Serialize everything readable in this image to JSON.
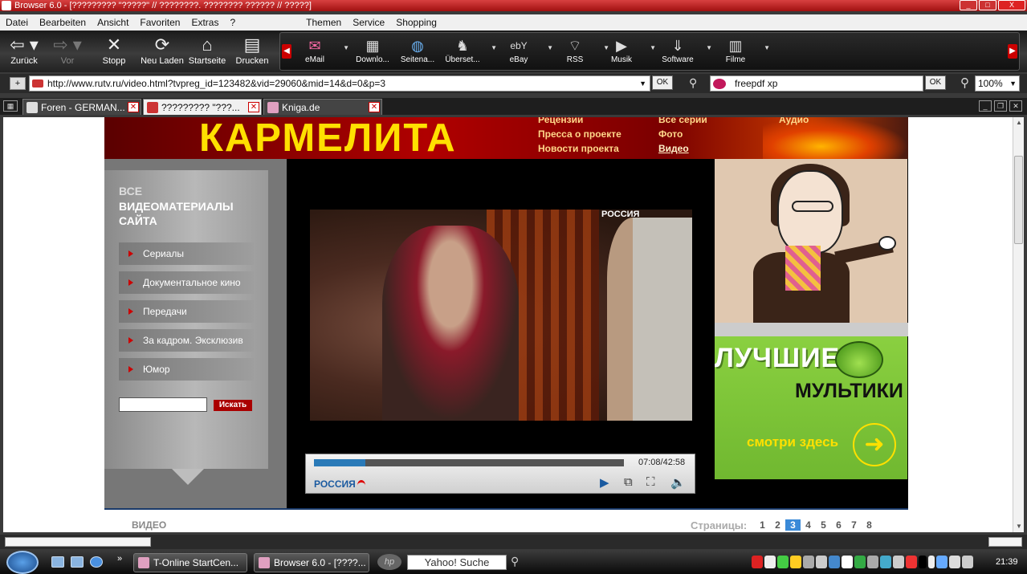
{
  "window": {
    "title": "Browser 6.0 - [????????? \"?????\" // ????????. ???????? ?????? // ?????]",
    "controls": [
      "_",
      "□",
      "X"
    ]
  },
  "menu": {
    "items_left": [
      "Datei",
      "Bearbeiten",
      "Ansicht",
      "Favoriten",
      "Extras",
      "?"
    ],
    "items_right": [
      "Themen",
      "Service",
      "Shopping"
    ]
  },
  "toolbar": {
    "back": "Zurück",
    "forward": "Vor",
    "stop": "Stopp",
    "reload": "Neu Laden",
    "home": "Startseite",
    "print": "Drucken"
  },
  "linkbar": {
    "items": [
      {
        "label": "eMail",
        "icon": "mail-icon"
      },
      {
        "label": "Downlo...",
        "icon": "download-icon"
      },
      {
        "label": "Seitena...",
        "icon": "globe-icon"
      },
      {
        "label": "Überset...",
        "icon": "translate-icon"
      },
      {
        "label": "eBay",
        "icon": "ebay-icon"
      },
      {
        "label": "RSS",
        "icon": "rss-icon"
      },
      {
        "label": "Musik",
        "icon": "music-icon"
      },
      {
        "label": "Software",
        "icon": "software-icon"
      },
      {
        "label": "Filme",
        "icon": "film-icon"
      }
    ]
  },
  "address": {
    "url": "http://www.rutv.ru/video.html?tvpreg_id=123482&vid=29060&mid=14&d=0&p=3",
    "go_label": "OK",
    "search_value": "freepdf xp",
    "search_go_label": "OK",
    "zoom": "100%"
  },
  "tabs": [
    {
      "label": "Foren - GERMAN...",
      "active": false
    },
    {
      "label": "????????? \"???...",
      "active": true
    },
    {
      "label": "Kniga.de",
      "active": false
    }
  ],
  "site": {
    "logo": "КАРМЕЛИТА",
    "header_links": [
      {
        "label": "Рецензии",
        "current": false
      },
      {
        "label": "Пресса о проекте",
        "current": false
      },
      {
        "label": "Новости проекта",
        "current": false
      },
      {
        "label": "Все серии",
        "current": false
      },
      {
        "label": "Фото",
        "current": false
      },
      {
        "label": "Видео",
        "current": true
      },
      {
        "label": "Аудио",
        "current": false
      }
    ],
    "sidebar": {
      "heading_line1": "ВСЕ",
      "heading_line2": "ВИДЕОМАТЕРИАЛЫ САЙТА",
      "items": [
        "Сериалы",
        "Документальное кино",
        "Передачи",
        "За кадром. Эксклюзив",
        "Юмор"
      ],
      "search_button": "Искать"
    },
    "player": {
      "channel_logo": "РОССИЯ",
      "time": "07:08/42:58",
      "progress": 0.166,
      "brand": "РОССИЯ"
    },
    "promo": {
      "title_line1": "ЛУЧШИЕ",
      "title_line2": "МУЛЬТИКИ",
      "cta": "смотри здесь"
    },
    "footer": {
      "section": "ВИДЕО",
      "pages_label": "Страницы:",
      "pages": [
        "1",
        "2",
        "3",
        "4",
        "5",
        "6",
        "7",
        "8"
      ],
      "current_page": "3"
    }
  },
  "taskbar": {
    "tasks": [
      {
        "label": "T-Online StartCen..."
      },
      {
        "label": "Browser 6.0 - [????..."
      }
    ],
    "hp_label": "hp",
    "search_label": "Yahoo! Suche",
    "clock": "21:39"
  }
}
